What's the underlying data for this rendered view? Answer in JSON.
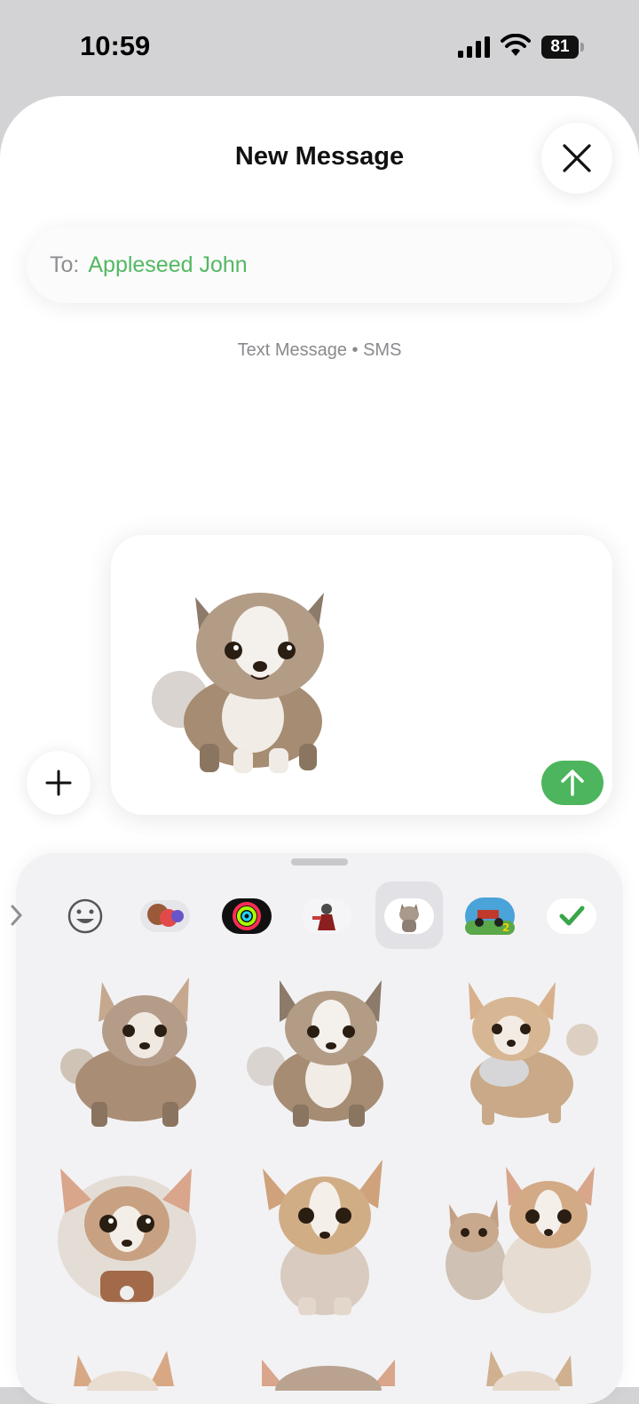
{
  "status": {
    "time": "10:59",
    "battery": "81"
  },
  "header": {
    "title": "New Message"
  },
  "recipient": {
    "label": "To:",
    "name": "Appleseed John"
  },
  "service_label": "Text Message • SMS",
  "compose": {
    "attachment": "dog sticker"
  },
  "drawer": {
    "apps": [
      "emoji-keyboard",
      "memoji-stickers",
      "activity-rings",
      "game-app",
      "dog-sticker-pack",
      "racing-game",
      "checkmark-app"
    ],
    "selected_app": "dog-sticker-pack"
  },
  "colors": {
    "accent_green": "#4cb55d",
    "recipient_green": "#53b862",
    "background_gray": "#d3d3d6"
  }
}
